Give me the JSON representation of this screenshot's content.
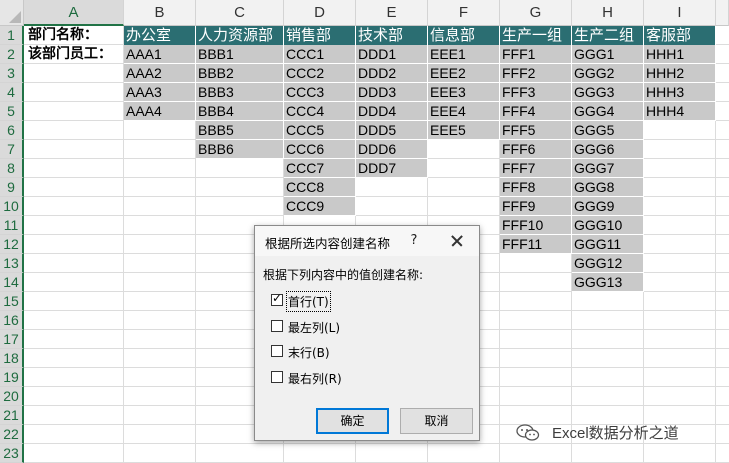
{
  "columns": [
    "A",
    "B",
    "C",
    "D",
    "E",
    "F",
    "G",
    "H",
    "I"
  ],
  "selected_column": "A",
  "rows": [
    "1",
    "2",
    "3",
    "4",
    "5",
    "6",
    "7",
    "8",
    "9",
    "10",
    "11",
    "12",
    "13",
    "14",
    "15",
    "16",
    "17",
    "18",
    "19",
    "20",
    "21",
    "22",
    "23"
  ],
  "labels": {
    "a1": "部门名称：",
    "a2": "该部门员工："
  },
  "departments": [
    {
      "name": "办公室",
      "staff": [
        "AAA1",
        "AAA2",
        "AAA3",
        "AAA4"
      ]
    },
    {
      "name": "人力资源部",
      "staff": [
        "BBB1",
        "BBB2",
        "BBB3",
        "BBB4",
        "BBB5",
        "BBB6"
      ]
    },
    {
      "name": "销售部",
      "staff": [
        "CCC1",
        "CCC2",
        "CCC3",
        "CCC4",
        "CCC5",
        "CCC6",
        "CCC7",
        "CCC8",
        "CCC9"
      ]
    },
    {
      "name": "技术部",
      "staff": [
        "DDD1",
        "DDD2",
        "DDD3",
        "DDD4",
        "DDD5",
        "DDD6",
        "DDD7"
      ]
    },
    {
      "name": "信息部",
      "staff": [
        "EEE1",
        "EEE2",
        "EEE3",
        "EEE4",
        "EEE5"
      ]
    },
    {
      "name": "生产一组",
      "staff": [
        "FFF1",
        "FFF2",
        "FFF3",
        "FFF4",
        "FFF5",
        "FFF6",
        "FFF7",
        "FFF8",
        "FFF9",
        "FFF10",
        "FFF11"
      ]
    },
    {
      "name": "生产二组",
      "staff": [
        "GGG1",
        "GGG2",
        "GGG3",
        "GGG4",
        "GGG5",
        "GGG6",
        "GGG7",
        "GGG8",
        "GGG9",
        "GGG10",
        "GGG11",
        "GGG12",
        "GGG13"
      ]
    },
    {
      "name": "客服部",
      "staff": [
        "HHH1",
        "HHH2",
        "HHH3",
        "HHH4"
      ]
    }
  ],
  "colors": {
    "header_fill": "#2b6e72",
    "data_fill": "#c9c9c9",
    "selection": "#217346"
  },
  "dialog": {
    "title": "根据所选内容创建名称",
    "help": "?",
    "prompt": "根据下列内容中的值创建名称:",
    "options": [
      {
        "label": "首行(T)",
        "checked": true
      },
      {
        "label": "最左列(L)",
        "checked": false
      },
      {
        "label": "末行(B)",
        "checked": false
      },
      {
        "label": "最右列(R)",
        "checked": false
      }
    ],
    "ok_label": "确定",
    "cancel_label": "取消"
  },
  "watermark": {
    "icon": "wechat-logo-icon",
    "text": "Excel数据分析之道"
  }
}
